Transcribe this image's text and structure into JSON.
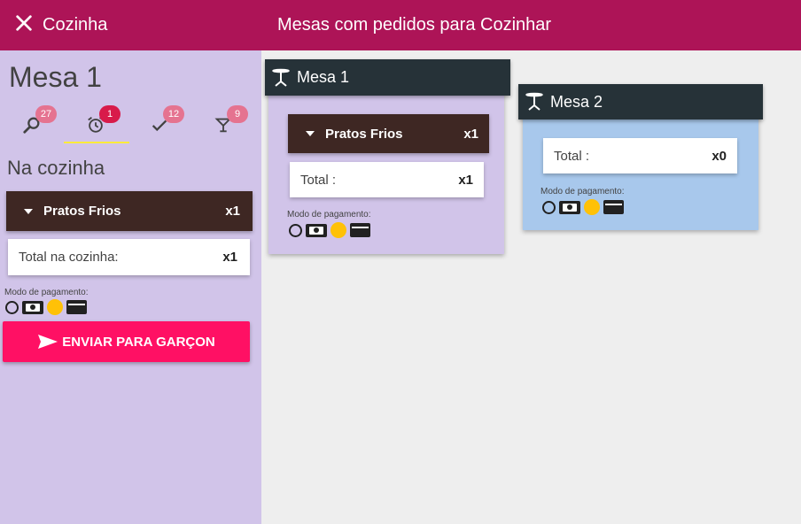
{
  "app": {
    "title": "Cozinha",
    "main_title": "Mesas com pedidos para Cozinhar"
  },
  "sidebar": {
    "mesa_title": "Mesa 1",
    "tabs": [
      {
        "icon": "search-icon",
        "badge": "27",
        "badge_style": "soft"
      },
      {
        "icon": "alarm-clock-icon",
        "badge": "1",
        "badge_style": "hard"
      },
      {
        "icon": "check-icon",
        "badge": "12",
        "badge_style": "soft"
      },
      {
        "icon": "cocktail-icon",
        "badge": "9",
        "badge_style": "soft"
      }
    ],
    "active_tab": 1,
    "section_title": "Na cozinha",
    "category": {
      "name": "Pratos Frios",
      "count": "x1"
    },
    "total": {
      "label": "Total na cozinha:",
      "count": "x1"
    },
    "payment_label": "Modo de pagamento:",
    "send_button": "ENVIAR PARA GARÇON"
  },
  "cards": [
    {
      "title": "Mesa 1",
      "category": {
        "name": "Pratos Frios",
        "count": "x1"
      },
      "total": {
        "label": "Total :",
        "count": "x1"
      },
      "payment_label": "Modo de pagamento:"
    },
    {
      "title": "Mesa 2",
      "total": {
        "label": "Total :",
        "count": "x0"
      },
      "payment_label": "Modo de pagamento:"
    }
  ],
  "colors": {
    "topbar": "#ad1457",
    "sidebar_bg": "#d1c4e9",
    "card1_bg": "#d1c4e9",
    "card2_bg": "#a8c8ec",
    "card_header": "#263238",
    "category_bar": "#3e2723",
    "send_button": "#ff1064",
    "tab_underline": "#ffeb3b",
    "coin": "#ffc107"
  }
}
